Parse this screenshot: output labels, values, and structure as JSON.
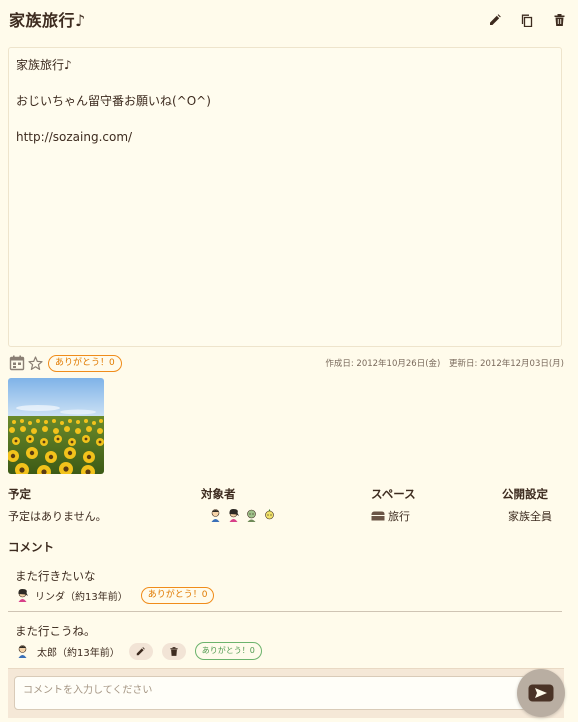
{
  "post": {
    "title": "家族旅行♪",
    "body_lines": [
      "家族旅行♪",
      "",
      "おじいちゃん留守番お願いね(^O^)",
      "",
      "http://sozaing.com/"
    ],
    "thanks_label": "ありがとう！0",
    "created": "作成日: 2012年10月26日(金)",
    "updated": "更新日: 2012年12月03日(月)"
  },
  "info": {
    "schedule_label": "予定",
    "schedule_value": "予定はありません。",
    "target_label": "対象者",
    "space_label": "スペース",
    "space_value": "旅行",
    "visibility_label": "公開設定",
    "visibility_value": "家族全員"
  },
  "comments": {
    "heading": "コメント",
    "items": [
      {
        "text": "また行きたいな",
        "author": "リンダ（約13年前）",
        "thanks": "ありがとう！0"
      },
      {
        "text": "また行こうね。",
        "author": "太郎（約13年前）",
        "thanks": "ありがとう！0"
      }
    ],
    "placeholder": "コメントを入力してください"
  },
  "colors": {
    "background": "#fffbeb",
    "thanks_orange": "#f08c1a",
    "thanks_green": "#6cb36c",
    "text": "#3d2b1f"
  },
  "icons": [
    "edit-icon",
    "copy-icon",
    "trash-icon",
    "calendar-icon",
    "star-icon",
    "folder-icon",
    "send-icon"
  ]
}
